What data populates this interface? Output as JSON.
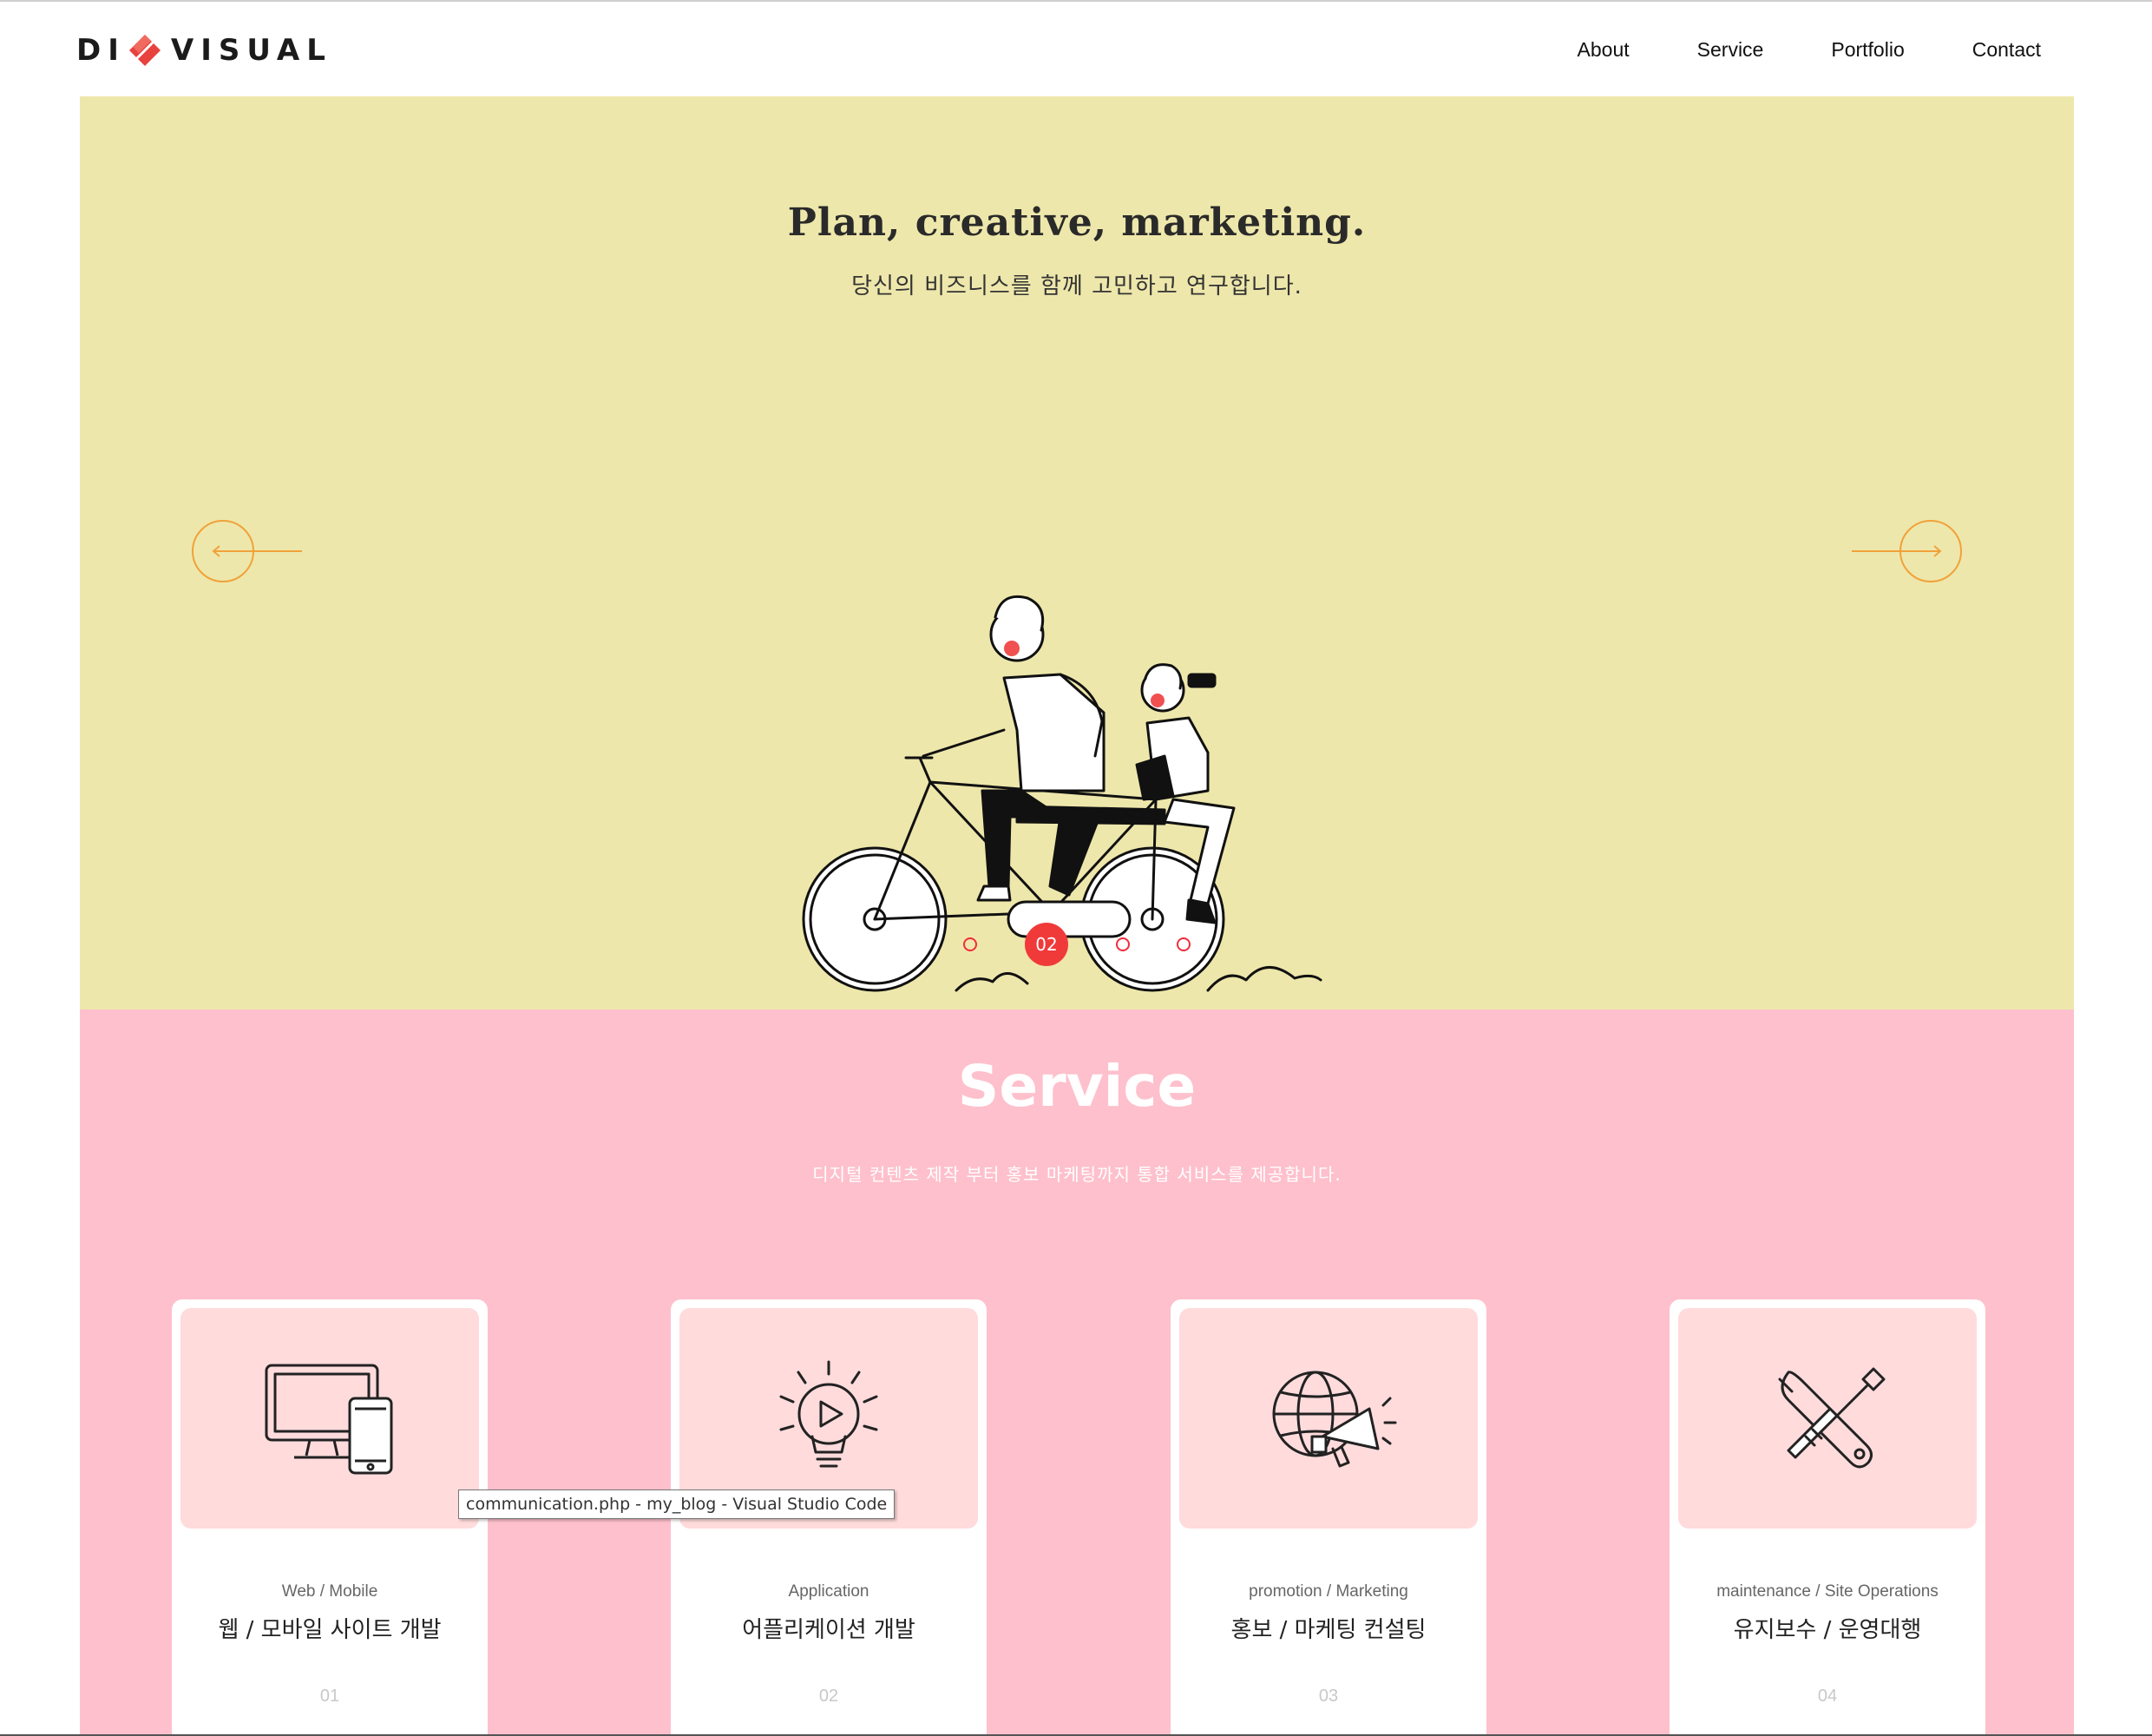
{
  "brand": {
    "logo_left": "DI",
    "logo_right": "VISUAL",
    "accent": "#e8423f"
  },
  "nav": {
    "items": [
      {
        "label": "About"
      },
      {
        "label": "Service"
      },
      {
        "label": "Portfolio"
      },
      {
        "label": "Contact"
      }
    ]
  },
  "hero": {
    "title": "Plan, creative, marketing.",
    "subtitle": "당신의 비즈니스를 함께 고민하고 연구합니다.",
    "bg": "#eee7ab",
    "arrow_color": "#f0a23a",
    "prev_icon": "arrow-left-icon",
    "next_icon": "arrow-right-icon",
    "active_slide_label": "02",
    "slide_count": 4,
    "active_slide_index": 1
  },
  "service": {
    "title": "Service",
    "subtitle": "디지털 컨텐츠 제작 부터 홍보 마케팅까지 통합 서비스를 제공합니다.",
    "bg": "#fec0cc",
    "cards": [
      {
        "icon": "monitor-mobile-icon",
        "en": "Web / Mobile",
        "ko": "웹 / 모바일 사이트 개발",
        "num": "01"
      },
      {
        "icon": "lightbulb-play-icon",
        "en": "Application",
        "ko": "어플리케이션 개발",
        "num": "02"
      },
      {
        "icon": "globe-megaphone-icon",
        "en": "promotion / Marketing",
        "ko": "홍보 / 마케팅 컨설팅",
        "num": "03"
      },
      {
        "icon": "tools-icon",
        "en": "maintenance / Site Operations",
        "ko": "유지보수 / 운영대행",
        "num": "04"
      }
    ]
  },
  "tooltip": {
    "text": "communication.php - my_blog - Visual Studio Code"
  }
}
